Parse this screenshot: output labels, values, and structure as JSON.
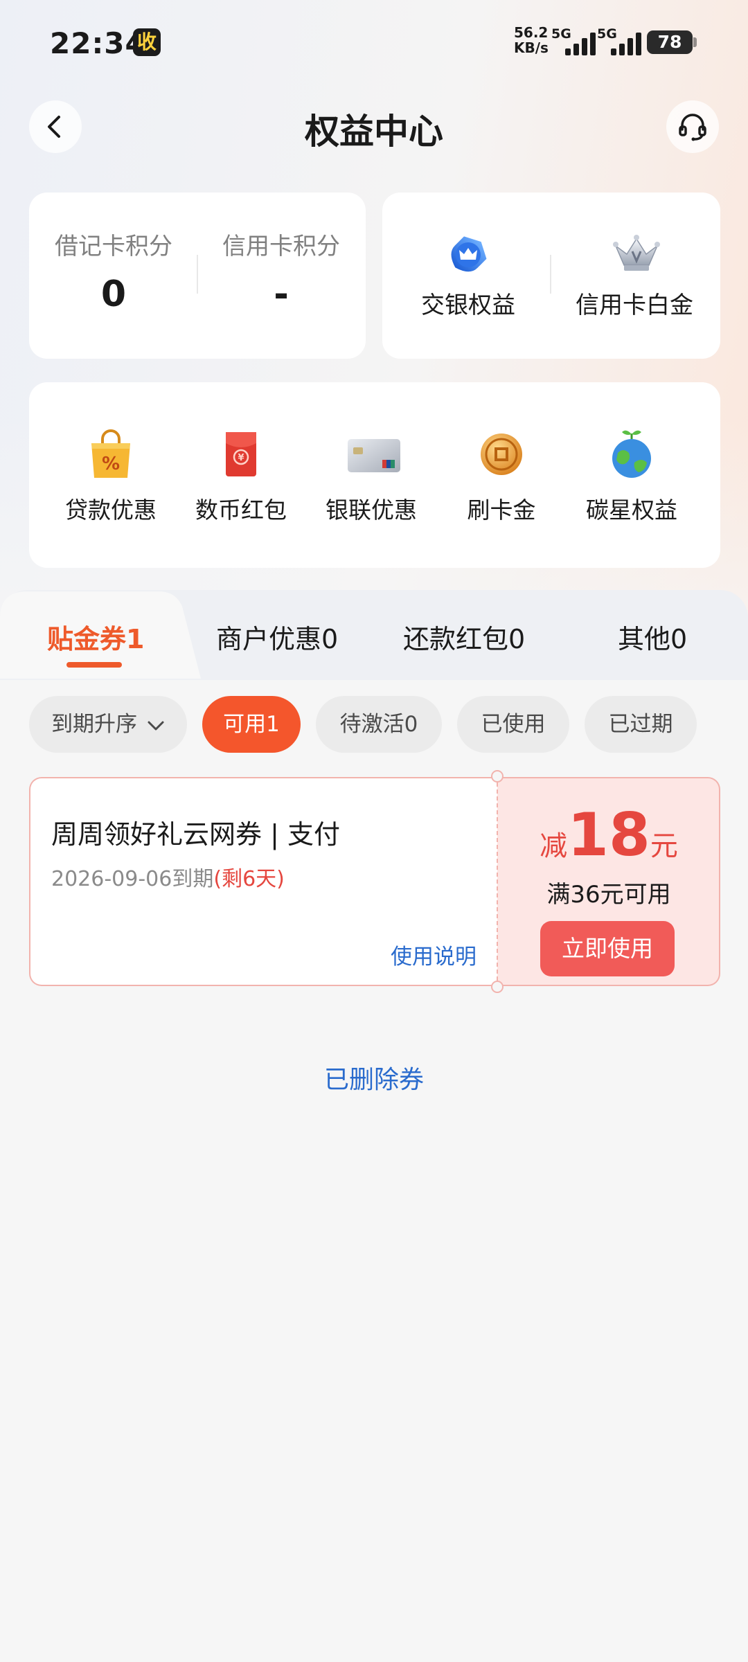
{
  "status_bar": {
    "time": "22:34",
    "app_badge": "收",
    "net_speed_value": "56.2",
    "net_speed_unit": "KB/s",
    "net_type_1": "5G",
    "net_type_2": "5G",
    "battery": "78"
  },
  "header": {
    "title": "权益中心"
  },
  "points": {
    "debit_label": "借记卡积分",
    "debit_value": "0",
    "credit_label": "信用卡积分",
    "credit_value": "-"
  },
  "benefits": [
    {
      "label": "交银权益",
      "icon": "crown-shield-icon"
    },
    {
      "label": "信用卡白金",
      "icon": "silver-crown-icon"
    }
  ],
  "quick_links": [
    {
      "label": "贷款优惠",
      "icon": "shopping-bag-percent-icon"
    },
    {
      "label": "数币红包",
      "icon": "red-envelope-icon"
    },
    {
      "label": "银联优惠",
      "icon": "unionpay-card-icon"
    },
    {
      "label": "刷卡金",
      "icon": "gold-coin-icon"
    },
    {
      "label": "碳星权益",
      "icon": "earth-sprout-icon"
    }
  ],
  "tabs": [
    {
      "label": "贴金券1",
      "active": true
    },
    {
      "label": "商户优惠0",
      "active": false
    },
    {
      "label": "还款红包0",
      "active": false
    },
    {
      "label": "其他0",
      "active": false
    }
  ],
  "filters": {
    "sort_label": "到期升序",
    "chips": [
      {
        "label": "可用1",
        "active": true
      },
      {
        "label": "待激活0",
        "active": false
      },
      {
        "label": "已使用",
        "active": false
      },
      {
        "label": "已过期",
        "active": false
      }
    ]
  },
  "coupon": {
    "title": "周周领好礼云网券 | 支付",
    "expiry_date": "2026-09-06到期",
    "remaining": "(剩6天)",
    "help_link": "使用说明",
    "amount_prefix": "减",
    "amount": "18",
    "amount_unit": "元",
    "condition": "满36元可用",
    "use_button": "立即使用"
  },
  "deleted_link": "已删除券",
  "colors": {
    "accent_orange": "#f4562c",
    "coupon_red": "#e5473f",
    "link_blue": "#2a6bcd"
  }
}
